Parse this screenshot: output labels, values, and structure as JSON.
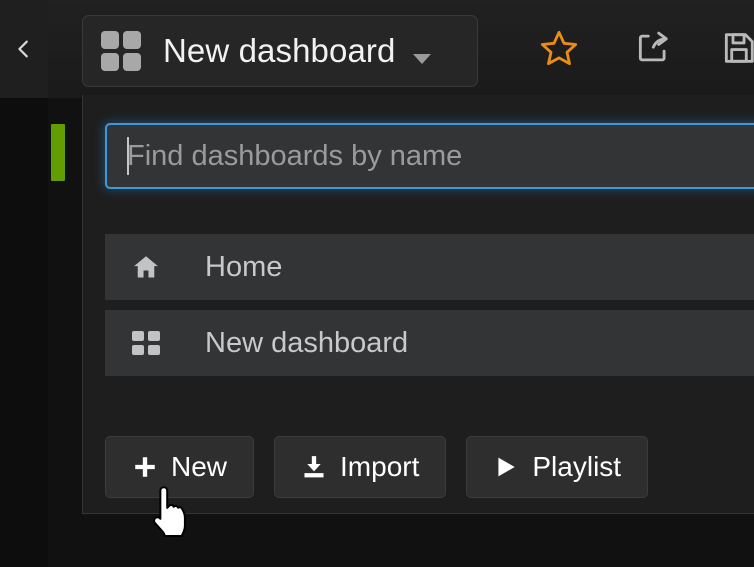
{
  "app": {
    "name": "Grafana dashboard picker",
    "background_color": "#111111",
    "accent_color": "#3d9ada",
    "favorite_color": "#eb8c16",
    "marker_color": "#629e02"
  },
  "sidebar": {
    "back_icon": "chevron-left-icon",
    "marker": "green-active-marker"
  },
  "toolbar": {
    "dashboard_picker": {
      "label": "New dashboard",
      "icon": "dashboard-grid-icon",
      "caret": "chevron-down-icon",
      "expanded": true
    },
    "actions": [
      {
        "name": "mark-as-favorite",
        "icon": "star-icon",
        "color": "#eb8c16"
      },
      {
        "name": "share-dashboard",
        "icon": "share-icon",
        "color": "#b9b9b9"
      },
      {
        "name": "save-dashboard",
        "icon": "floppy-disk-save-icon",
        "color": "#b9b9b9"
      }
    ]
  },
  "dropdown": {
    "search": {
      "placeholder": "Find dashboards by name",
      "value": "",
      "focused": true
    },
    "results": [
      {
        "label": "Home",
        "icon": "home-icon"
      },
      {
        "label": "New dashboard",
        "icon": "dashboard-grid-icon"
      }
    ],
    "buttons": [
      {
        "label": "New",
        "icon": "plus-icon"
      },
      {
        "label": "Import",
        "icon": "download-import-icon"
      },
      {
        "label": "Playlist",
        "icon": "play-triangle-icon"
      }
    ]
  },
  "cursor": {
    "type": "pointing-hand-cursor"
  }
}
